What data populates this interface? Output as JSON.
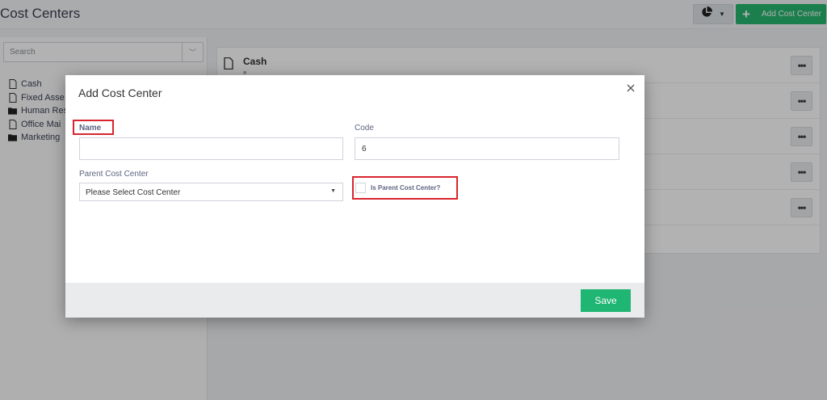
{
  "header": {
    "title": "Cost Centers",
    "add_button_label": "Add Cost Center"
  },
  "sidebar": {
    "search_placeholder": "Search",
    "items": [
      {
        "label": "Cash",
        "icon": "file-icon"
      },
      {
        "label": "Fixed Asse",
        "icon": "file-icon"
      },
      {
        "label": "Human Res",
        "icon": "folder-icon"
      },
      {
        "label": "Office Mai",
        "icon": "file-icon"
      },
      {
        "label": "Marketing",
        "icon": "folder-icon"
      }
    ]
  },
  "list": {
    "rows": [
      {
        "name": "Cash"
      }
    ]
  },
  "modal": {
    "title": "Add Cost Center",
    "name_label": "Name",
    "name_value": "",
    "code_label": "Code",
    "code_value": "6",
    "parent_label": "Parent Cost Center",
    "parent_selected": "Please Select Cost Center",
    "is_parent_label": "Is Parent Cost Center?",
    "is_parent_checked": false,
    "save_label": "Save"
  },
  "colors": {
    "accent": "#27b56f",
    "highlight": "#d9252f"
  }
}
